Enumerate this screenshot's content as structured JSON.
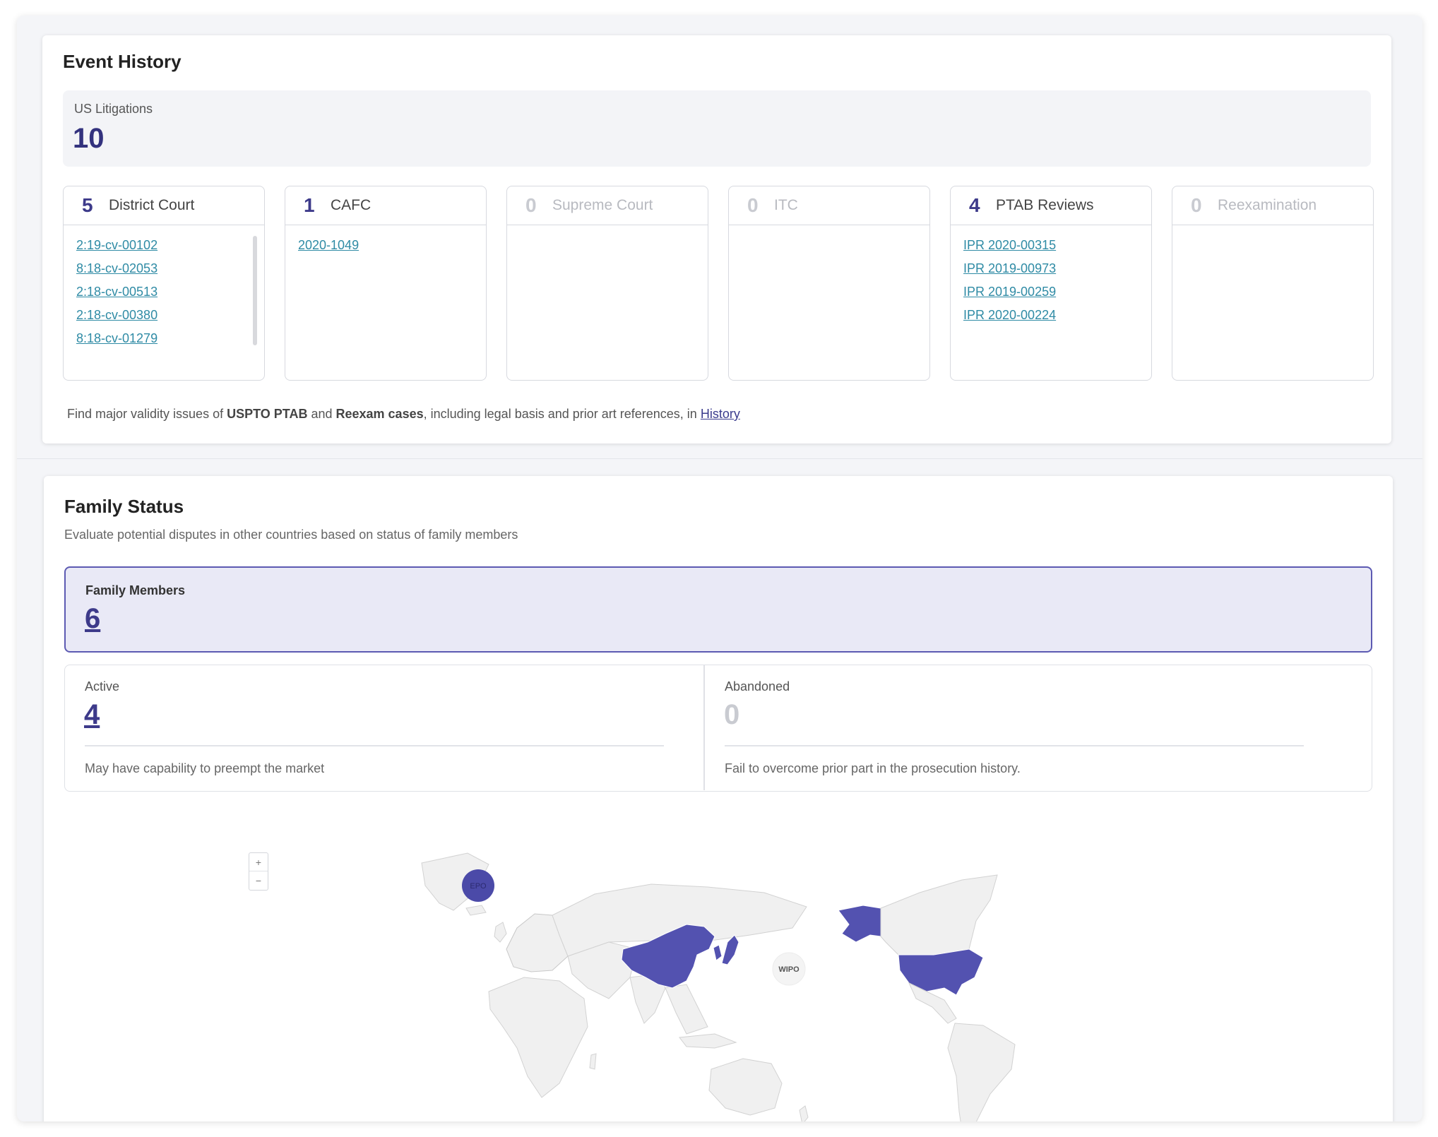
{
  "event_history": {
    "title": "Event History",
    "summary": {
      "label": "US Litigations",
      "value": "10"
    },
    "court_types": [
      {
        "count": "5",
        "name": "District Court",
        "cases": [
          "2:19-cv-00102",
          "8:18-cv-02053",
          "2:18-cv-00513",
          "2:18-cv-00380",
          "8:18-cv-01279"
        ]
      },
      {
        "count": "1",
        "name": "CAFC",
        "cases": [
          "2020-1049"
        ]
      },
      {
        "count": "0",
        "name": "Supreme Court",
        "cases": []
      },
      {
        "count": "0",
        "name": "ITC",
        "cases": []
      },
      {
        "count": "4",
        "name": "PTAB Reviews",
        "cases": [
          "IPR 2020-00315",
          "IPR 2019-00973",
          "IPR 2019-00259",
          "IPR 2020-00224"
        ]
      },
      {
        "count": "0",
        "name": "Reexamination",
        "cases": []
      }
    ],
    "note": {
      "prefix": "Find major validity issues of ",
      "bold1": "USPTO PTAB",
      "mid": " and ",
      "bold2": "Reexam cases",
      "suffix": ", including legal basis and prior art references, in ",
      "link": "History"
    }
  },
  "family_status": {
    "title": "Family Status",
    "subtitle": "Evaluate potential disputes in other countries based on status of family members",
    "members": {
      "label": "Family Members",
      "value": "6"
    },
    "active": {
      "label": "Active",
      "value": "4",
      "description": "May have capability to preempt the market"
    },
    "abandoned": {
      "label": "Abandoned",
      "value": "0",
      "description": "Fail to overcome prior part in the prosecution history."
    },
    "map": {
      "zoom_in": "+",
      "zoom_out": "−",
      "markers": {
        "epo": "EPO",
        "wipo": "WIPO"
      },
      "colors": {
        "highlight": "#5352b0",
        "land": "#f0f0f0",
        "border": "#d2d2d2",
        "marker": "#4b4aa8"
      }
    }
  }
}
